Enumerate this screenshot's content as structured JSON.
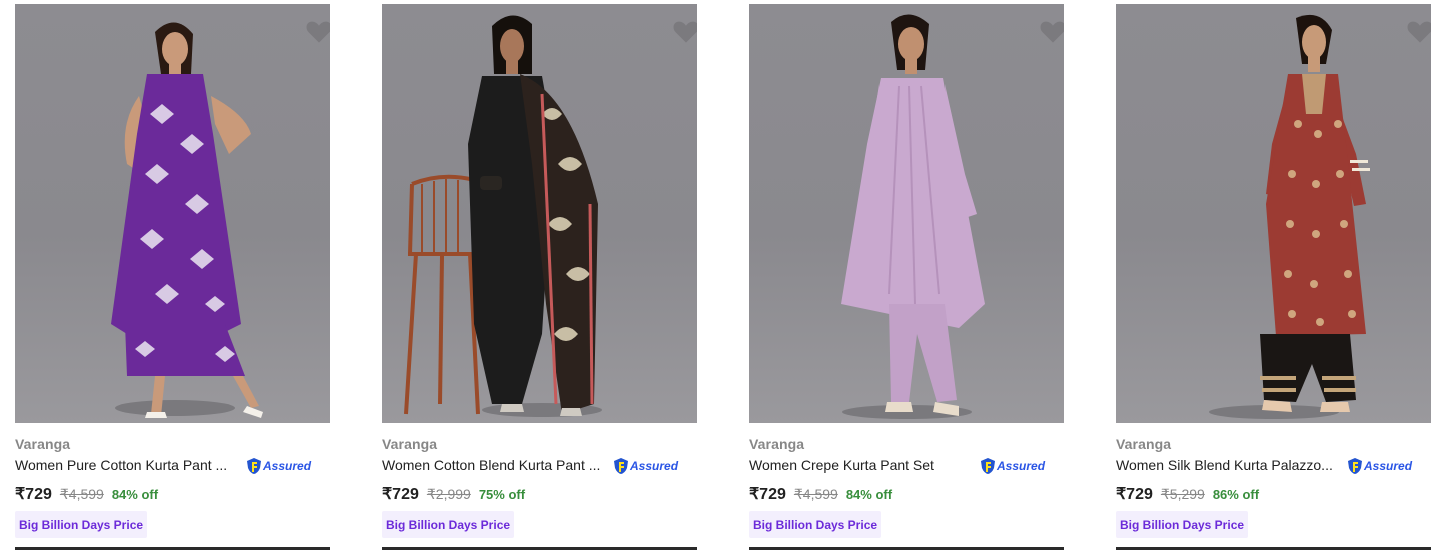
{
  "products": [
    {
      "brand": "Varanga",
      "title": "Women Pure Cotton Kurta Pant ...",
      "assured": "Assured",
      "price": "₹729",
      "mrp": "₹4,599",
      "discount": "84% off",
      "badge": "Big Billion Days Price",
      "outfit_color": "#6b2a9a"
    },
    {
      "brand": "Varanga",
      "title": "Women Cotton Blend Kurta Pant ...",
      "assured": "Assured",
      "price": "₹729",
      "mrp": "₹2,999",
      "discount": "75% off",
      "badge": "Big Billion Days Price",
      "outfit_color": "#1c1c1c"
    },
    {
      "brand": "Varanga",
      "title": "Women Crepe Kurta Pant Set",
      "assured": "Assured",
      "price": "₹729",
      "mrp": "₹4,599",
      "discount": "84% off",
      "badge": "Big Billion Days Price",
      "outfit_color": "#c9a9cf"
    },
    {
      "brand": "Varanga",
      "title": "Women Silk Blend Kurta Palazzo...",
      "assured": "Assured",
      "price": "₹729",
      "mrp": "₹5,299",
      "discount": "86% off",
      "badge": "Big Billion Days Price",
      "outfit_color": "#9c3b33"
    }
  ],
  "icons": {
    "wishlist": "heart-icon",
    "assured": "flipkart-assured-icon"
  }
}
